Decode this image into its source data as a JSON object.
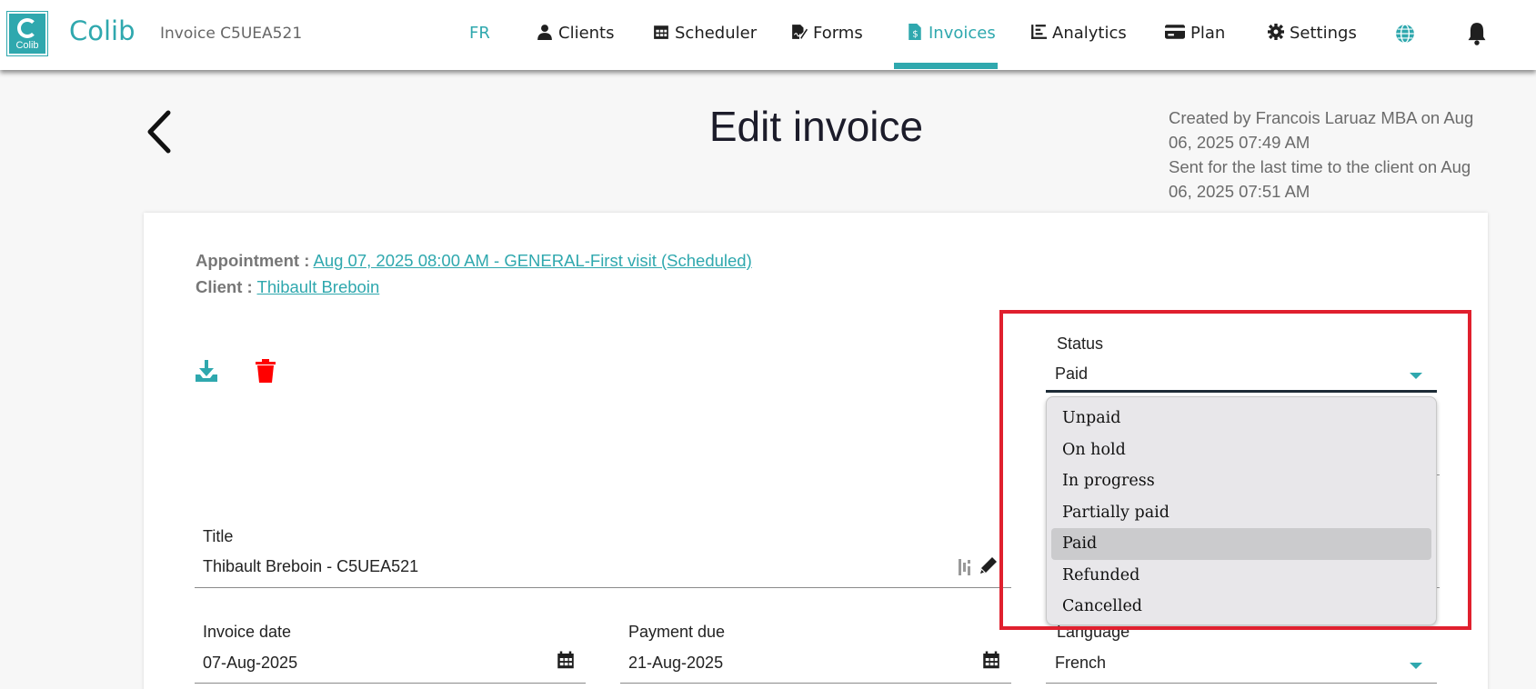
{
  "app": {
    "brand": "Colib",
    "logo_text": "Colib",
    "invoice_ref": "Invoice C5UEA521"
  },
  "nav": {
    "lang": "FR",
    "items": [
      {
        "label": "Clients",
        "icon": "user-icon"
      },
      {
        "label": "Scheduler",
        "icon": "calendar-icon"
      },
      {
        "label": "Forms",
        "icon": "signature-icon"
      },
      {
        "label": "Invoices",
        "icon": "invoice-icon",
        "active": true
      },
      {
        "label": "Analytics",
        "icon": "chart-icon"
      },
      {
        "label": "Plan",
        "icon": "credit-card-icon"
      },
      {
        "label": "Settings",
        "icon": "gear-icon"
      }
    ],
    "globe_icon": "globe-icon",
    "bell_icon": "bell-icon"
  },
  "header": {
    "title": "Edit invoice",
    "created": "Created by Francois Laruaz MBA on Aug 06, 2025 07:49 AM",
    "sent": "Sent for the last time to the client on Aug 06, 2025 07:51 AM"
  },
  "invoice": {
    "appointment_label": "Appointment :",
    "appointment_value": "Aug 07, 2025 08:00 AM - GENERAL-First visit (Scheduled)",
    "client_label": "Client :",
    "client_value": "Thibault Breboin",
    "title_label": "Title",
    "title_value": "Thibault Breboin - C5UEA521",
    "invoice_date_label": "Invoice date",
    "invoice_date_value": "07-Aug-2025",
    "payment_due_label": "Payment due",
    "payment_due_value": "21-Aug-2025",
    "language_label": "Language",
    "language_value": "French",
    "status_label": "Status",
    "status_value": "Paid"
  },
  "status_options": [
    "Unpaid",
    "On hold",
    "In progress",
    "Partially paid",
    "Paid",
    "Refunded",
    "Cancelled"
  ],
  "status_selected_index": 4,
  "colors": {
    "accent": "#2fa8ae",
    "delete": "#ff0000",
    "highlight": "#e0202e"
  }
}
